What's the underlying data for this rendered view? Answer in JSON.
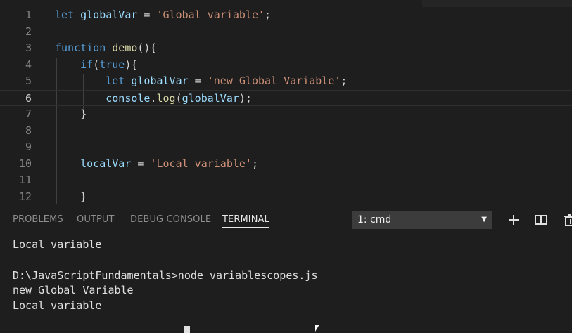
{
  "editor": {
    "lines": [
      {
        "num": "1",
        "parts": [
          [
            "kw",
            "let "
          ],
          [
            "var",
            "globalVar"
          ],
          [
            "plain",
            " = "
          ],
          [
            "str",
            "'Global variable'"
          ],
          [
            "plain",
            ";"
          ]
        ]
      },
      {
        "num": "2",
        "parts": []
      },
      {
        "num": "3",
        "parts": [
          [
            "kw",
            "function "
          ],
          [
            "fn",
            "demo"
          ],
          [
            "plain",
            "(){"
          ]
        ]
      },
      {
        "num": "4",
        "parts": [
          [
            "plain",
            "    "
          ],
          [
            "kw",
            "if"
          ],
          [
            "plain",
            "("
          ],
          [
            "kw",
            "true"
          ],
          [
            "plain",
            "){"
          ]
        ]
      },
      {
        "num": "5",
        "parts": [
          [
            "plain",
            "        "
          ],
          [
            "kw",
            "let "
          ],
          [
            "var",
            "globalVar"
          ],
          [
            "plain",
            " = "
          ],
          [
            "str",
            "'new Global Variable'"
          ],
          [
            "plain",
            ";"
          ]
        ]
      },
      {
        "num": "6",
        "parts": [
          [
            "plain",
            "        "
          ],
          [
            "var",
            "console"
          ],
          [
            "plain",
            "."
          ],
          [
            "fn",
            "log"
          ],
          [
            "plain",
            "("
          ],
          [
            "var",
            "globalVar"
          ],
          [
            "plain",
            ");"
          ]
        ]
      },
      {
        "num": "7",
        "parts": [
          [
            "plain",
            "    }"
          ]
        ]
      },
      {
        "num": "8",
        "parts": []
      },
      {
        "num": "9",
        "parts": []
      },
      {
        "num": "10",
        "parts": [
          [
            "plain",
            "    "
          ],
          [
            "var",
            "localVar"
          ],
          [
            "plain",
            " = "
          ],
          [
            "str",
            "'Local variable'"
          ],
          [
            "plain",
            ";"
          ]
        ]
      },
      {
        "num": "11",
        "parts": []
      },
      {
        "num": "12",
        "parts": [
          [
            "plain",
            "    }"
          ]
        ]
      }
    ],
    "active_line": "6"
  },
  "panel": {
    "tabs": [
      "PROBLEMS",
      "OUTPUT",
      "DEBUG CONSOLE",
      "TERMINAL"
    ],
    "active_tab": "TERMINAL",
    "terminal_select": "1: cmd",
    "icons": [
      "plus-icon",
      "split-icon",
      "trash-icon"
    ]
  },
  "terminal": {
    "lines": [
      "Local variable",
      "",
      "D:\\JavaScriptFundamentals>node variablescopes.js",
      "new Global Variable",
      "Local variable"
    ]
  },
  "colors": {
    "background": "#1e1e1e",
    "keyword": "#569cd6",
    "function": "#dcdcaa",
    "variable": "#9cdcfe",
    "string": "#ce9178",
    "line_number": "#858585"
  }
}
